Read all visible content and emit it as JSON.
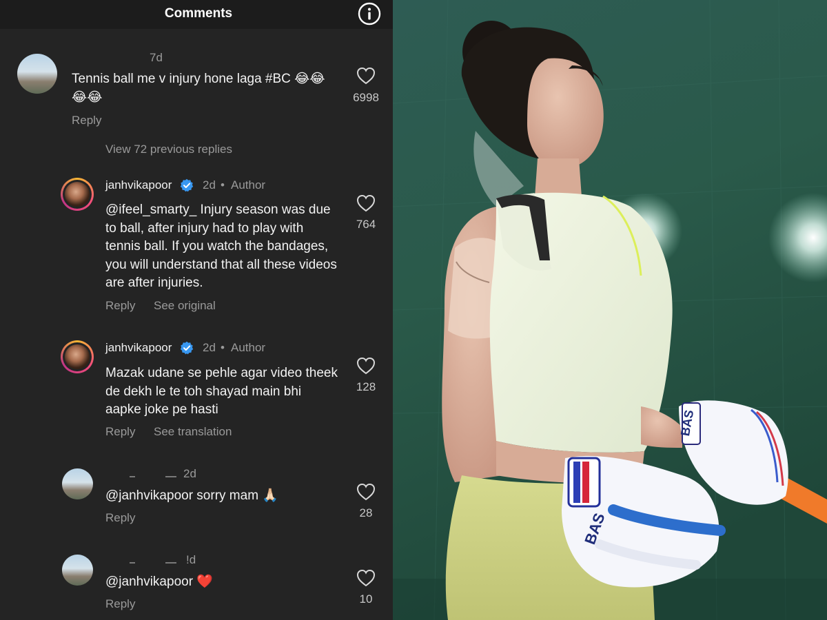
{
  "header": {
    "title": "Comments"
  },
  "comments": [
    {
      "time": "7d",
      "text": "Tennis ball me v injury hone laga #BC 😂😂😂😂",
      "likes": "6998",
      "reply_label": "Reply"
    }
  ],
  "view_replies_label": "View 72 previous replies",
  "replies": [
    {
      "username": "janhvikapoor",
      "time": "2d",
      "author_badge": "Author",
      "text": "@ifeel_smarty_ Injury season was due to ball, after injury had to play with tennis ball. If you watch the bandages, you will understand that all these videos are after injuries.",
      "likes": "764",
      "reply_label": "Reply",
      "secondary_action": "See original"
    },
    {
      "username": "janhvikapoor",
      "time": "2d",
      "author_badge": "Author",
      "text": "Mazak udane se pehle agar video theek de dekh le te toh shayad main bhi aapke joke pe hasti",
      "likes": "128",
      "reply_label": "Reply",
      "secondary_action": "See translation"
    },
    {
      "time": "2d",
      "text": "@janhvikapoor sorry mam 🙏🏻",
      "likes": "28",
      "reply_label": "Reply"
    },
    {
      "time": "!d",
      "text": "@janhvikapoor ❤️",
      "likes": "10",
      "reply_label": "Reply"
    }
  ],
  "photo": {
    "glove_text_1": "BAS",
    "glove_text_2": "BAS"
  },
  "colors": {
    "panel_background": "#242424",
    "header_background": "#1c1c1c",
    "muted_text": "#9a9a9a",
    "verified_blue": "#3897f0",
    "heart_red": "#e0245e",
    "court_green": "#2f5a4e",
    "bat_orange": "#f07a2a"
  }
}
